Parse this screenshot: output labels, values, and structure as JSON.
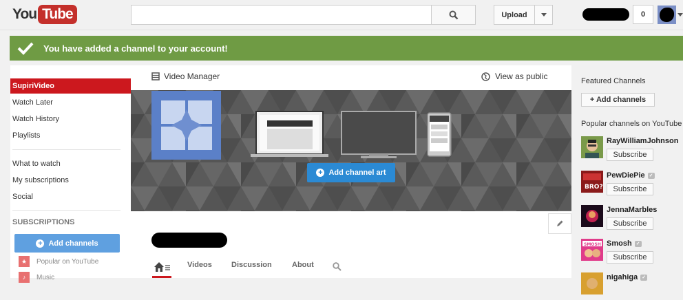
{
  "header": {
    "logo_you": "You",
    "logo_tube": "Tube",
    "search_placeholder": "",
    "upload_label": "Upload",
    "notification_count": "0"
  },
  "alert": {
    "message": "You have added a channel to your account!"
  },
  "sidebar": {
    "items": [
      {
        "label": "SupiriVideo"
      },
      {
        "label": "Watch Later"
      },
      {
        "label": "Watch History"
      },
      {
        "label": "Playlists"
      },
      {
        "label": "What to watch"
      },
      {
        "label": "My subscriptions"
      },
      {
        "label": "Social"
      }
    ],
    "subscriptions_heading": "SUBSCRIPTIONS",
    "add_channels_label": "Add channels",
    "subs": [
      {
        "label": "Popular on YouTube"
      },
      {
        "label": "Music"
      }
    ]
  },
  "main": {
    "video_manager_label": "Video Manager",
    "view_as_public_label": "View as public",
    "add_channel_art_label": "Add channel art",
    "tabs": [
      {
        "label": "Videos"
      },
      {
        "label": "Discussion"
      },
      {
        "label": "About"
      }
    ]
  },
  "right": {
    "featured_label": "Featured Channels",
    "add_channels_label": "+ Add channels",
    "popular_label": "Popular channels on YouTube",
    "subscribe_label": "Subscribe",
    "channels": [
      {
        "name": "RayWilliamJohnson",
        "verified": false
      },
      {
        "name": "PewDiePie",
        "verified": true
      },
      {
        "name": "JennaMarbles",
        "verified": false
      },
      {
        "name": "Smosh",
        "verified": true
      },
      {
        "name": "nigahiga",
        "verified": true
      }
    ]
  },
  "colors": {
    "brand_red": "#cc181e",
    "alert_green": "#6f9b44",
    "button_blue": "#2b8ad4"
  }
}
